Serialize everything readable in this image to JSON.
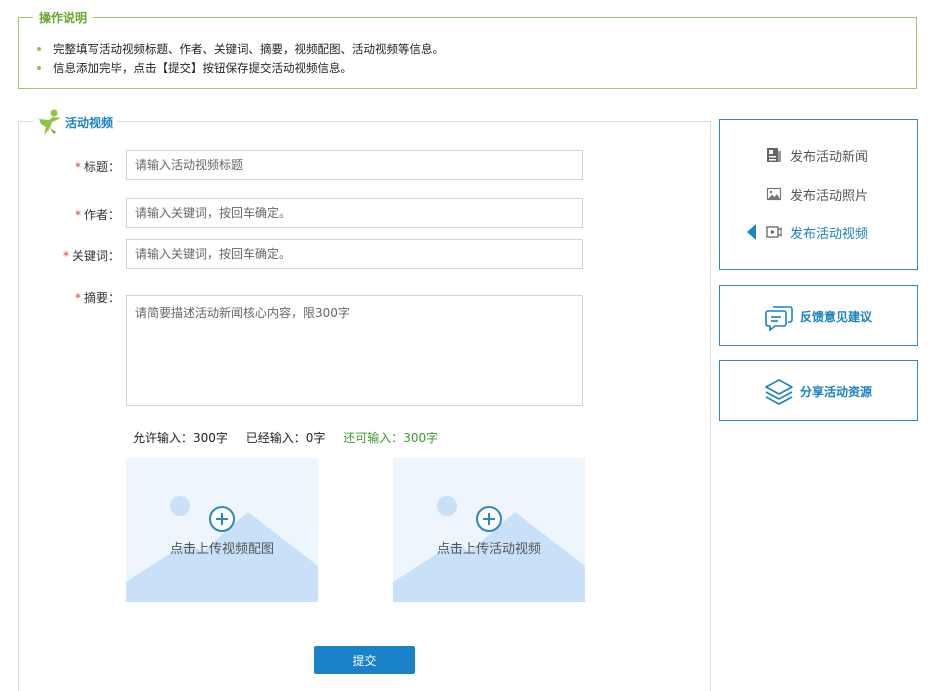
{
  "instructions": {
    "title": "操作说明",
    "items": [
      "完整填写活动视频标题、作者、关键词、摘要，视频配图、活动视频等信息。",
      "信息添加完毕，点击【提交】按钮保存提交活动视频信息。"
    ]
  },
  "form": {
    "title": "活动视频",
    "required_mark": "*",
    "fields": {
      "title": {
        "label": "标题：",
        "placeholder": "请输入活动视频标题"
      },
      "author": {
        "label": "作者：",
        "placeholder": "请输入关键词，按回车确定。"
      },
      "keywords": {
        "label": "关键词：",
        "placeholder": "请输入关键词，按回车确定。"
      },
      "summary": {
        "label": "摘要：",
        "placeholder": "请简要描述活动新闻核心内容，限300字"
      }
    },
    "counts": {
      "allowed": "允许输入：300字",
      "entered": "已经输入：0字",
      "remaining": "还可输入：300字"
    },
    "uploads": {
      "cover": "点击上传视频配图",
      "video": "点击上传活动视频"
    },
    "submit_label": "提交"
  },
  "sidebar": {
    "nav": [
      {
        "label": "发布活动新闻",
        "icon": "news-icon",
        "active": false
      },
      {
        "label": "发布活动照片",
        "icon": "photo-icon",
        "active": false
      },
      {
        "label": "发布活动视频",
        "icon": "video-icon",
        "active": true
      }
    ],
    "feedback_label": "反馈意见建议",
    "share_label": "分享活动资源"
  },
  "colors": {
    "accent_blue": "#1a82c4",
    "instruction_green": "#9cc86a",
    "required_red": "#e53935",
    "remaining_green": "#3c9b2e"
  }
}
